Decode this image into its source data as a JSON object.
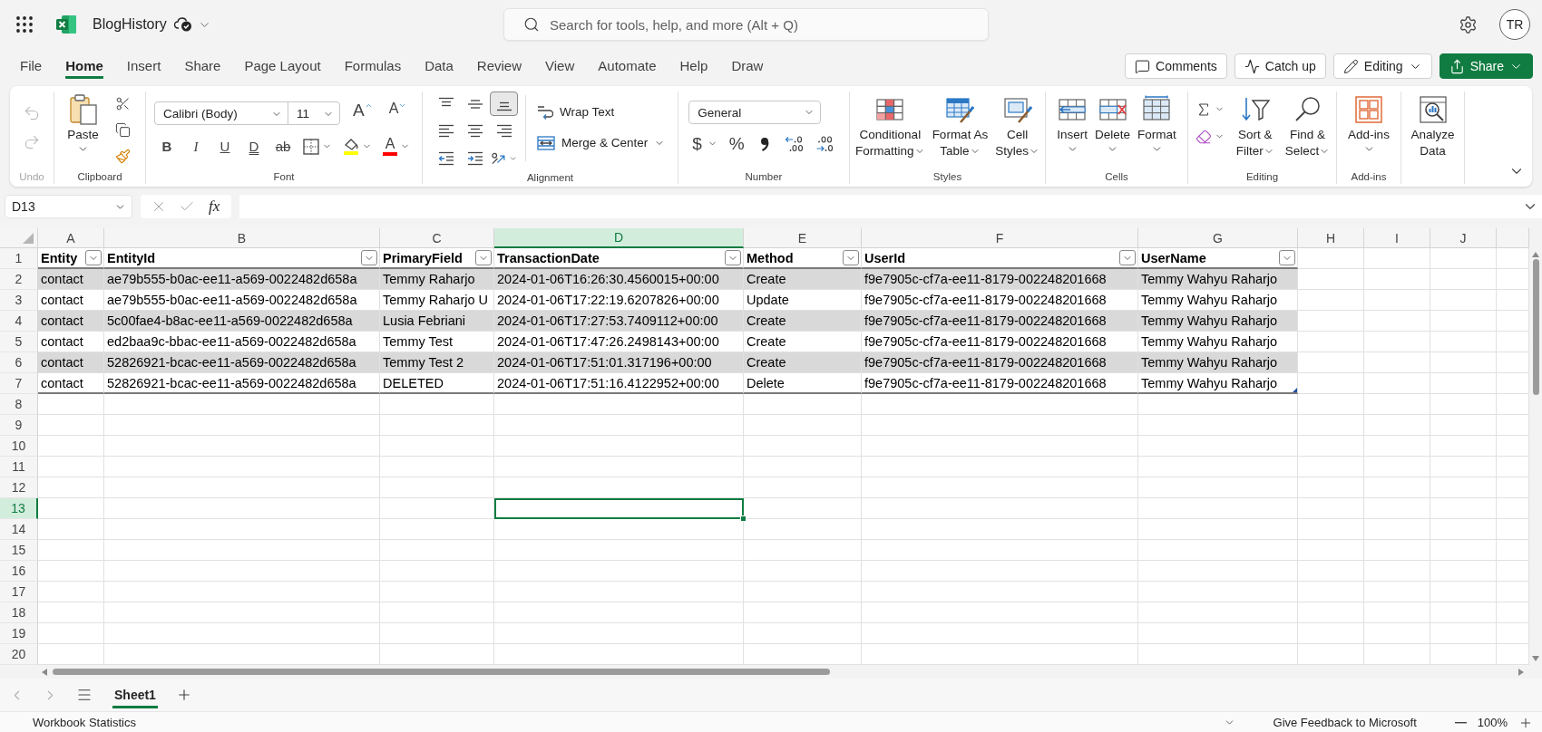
{
  "title_bar": {
    "file_name": "BlogHistory",
    "search": {
      "placeholder": "Search for tools, help, and more (Alt + Q)"
    },
    "avatar": "TR"
  },
  "ribbon_tabs": [
    {
      "label": "File",
      "selected": false
    },
    {
      "label": "Home",
      "selected": true
    },
    {
      "label": "Insert",
      "selected": false
    },
    {
      "label": "Share",
      "selected": false
    },
    {
      "label": "Page Layout",
      "selected": false
    },
    {
      "label": "Formulas",
      "selected": false
    },
    {
      "label": "Data",
      "selected": false
    },
    {
      "label": "Review",
      "selected": false
    },
    {
      "label": "View",
      "selected": false
    },
    {
      "label": "Automate",
      "selected": false
    },
    {
      "label": "Help",
      "selected": false
    },
    {
      "label": "Draw",
      "selected": false
    }
  ],
  "header_buttons": [
    {
      "kind": "comments",
      "label": "Comments"
    },
    {
      "kind": "catch_up",
      "label": "Catch up"
    },
    {
      "kind": "editing",
      "label": "Editing"
    },
    {
      "kind": "share",
      "label": "Share"
    }
  ],
  "ribbon": {
    "groups": [
      {
        "kind": "undo",
        "label": "Undo",
        "disabled": true
      },
      {
        "kind": "clipboard",
        "label": "Clipboard",
        "paste": "Paste"
      },
      {
        "kind": "font",
        "label": "Font",
        "font_name": "Calibri (Body)",
        "font_size": "11",
        "size_buttons": [
          {
            "kind": "grow",
            "label": "A"
          },
          {
            "kind": "shrink",
            "label": "A"
          }
        ],
        "style_buttons": [
          {
            "kind": "bold",
            "label": "B"
          },
          {
            "kind": "italic",
            "label": "I"
          },
          {
            "kind": "underline",
            "label": "U"
          },
          {
            "kind": "double_underline",
            "label": "D"
          },
          {
            "kind": "strikethrough",
            "label": "ab"
          }
        ],
        "highlight": {
          "color": "#ffff00"
        },
        "font_color": {
          "label": "A",
          "color": "#ff0000"
        }
      },
      {
        "kind": "alignment",
        "label": "Alignment",
        "align_buttons": [
          {
            "kind": "top",
            "selected": false
          },
          {
            "kind": "middle",
            "selected": false
          },
          {
            "kind": "bottom",
            "selected": true
          },
          {
            "kind": "left",
            "selected": false
          },
          {
            "kind": "center",
            "selected": false
          },
          {
            "kind": "right",
            "selected": false
          },
          {
            "kind": "outdent",
            "selected": false
          },
          {
            "kind": "indent",
            "selected": false
          },
          {
            "kind": "orientation",
            "selected": false
          }
        ],
        "wrap_text": "Wrap Text",
        "merge": "Merge & Center"
      },
      {
        "kind": "number",
        "label": "Number",
        "format": "General",
        "currency": "$",
        "percent": "%"
      },
      {
        "kind": "large",
        "label": "Styles",
        "buttons": [
          {
            "kind": "conditional_formatting",
            "lines": [
              "Conditional",
              "Formatting"
            ],
            "caret": true
          },
          {
            "kind": "format_as_table",
            "lines": [
              "Format As",
              "Table"
            ],
            "caret": true
          },
          {
            "kind": "cell_styles",
            "lines": [
              "Cell",
              "Styles"
            ],
            "caret": true
          }
        ]
      },
      {
        "kind": "large",
        "label": "Cells",
        "buttons": [
          {
            "kind": "insert",
            "lines": [
              "Insert"
            ],
            "caret": true
          },
          {
            "kind": "delete",
            "lines": [
              "Delete"
            ],
            "caret": true
          },
          {
            "kind": "format",
            "lines": [
              "Format"
            ],
            "caret": true
          }
        ]
      },
      {
        "kind": "editing",
        "label": "Editing",
        "buttons": [
          {
            "kind": "sort_filter",
            "lines": [
              "Sort &",
              "Filter"
            ],
            "caret": true
          },
          {
            "kind": "find_select",
            "lines": [
              "Find &",
              "Select"
            ],
            "caret": true
          }
        ]
      },
      {
        "kind": "large",
        "label": "Add-ins",
        "buttons": [
          {
            "kind": "add_ins",
            "lines": [
              "Add-ins"
            ],
            "caret": true
          }
        ]
      },
      {
        "kind": "large",
        "buttons": [
          {
            "kind": "analyze_data",
            "lines": [
              "Analyze",
              "Data"
            ],
            "caret": false
          }
        ]
      }
    ]
  },
  "formula_bar": {
    "name_box": "D13",
    "function_label": "fx"
  },
  "sheet": {
    "columns": [
      {
        "label": "A",
        "selected": false
      },
      {
        "label": "B",
        "selected": false
      },
      {
        "label": "C",
        "selected": false
      },
      {
        "label": "D",
        "selected": true
      },
      {
        "label": "E",
        "selected": false
      },
      {
        "label": "F",
        "selected": false
      },
      {
        "label": "G",
        "selected": false
      },
      {
        "label": "H",
        "selected": false
      },
      {
        "label": "I",
        "selected": false
      },
      {
        "label": "J",
        "selected": false
      }
    ],
    "row_headers": [
      {
        "label": "1",
        "selected": false
      },
      {
        "label": "2",
        "selected": false
      },
      {
        "label": "3",
        "selected": false
      },
      {
        "label": "4",
        "selected": false
      },
      {
        "label": "5",
        "selected": false
      },
      {
        "label": "6",
        "selected": false
      },
      {
        "label": "7",
        "selected": false
      },
      {
        "label": "8",
        "selected": false
      },
      {
        "label": "9",
        "selected": false
      },
      {
        "label": "10",
        "selected": false
      },
      {
        "label": "11",
        "selected": false
      },
      {
        "label": "12",
        "selected": false
      },
      {
        "label": "13",
        "selected": true
      },
      {
        "label": "14",
        "selected": false
      },
      {
        "label": "15",
        "selected": false
      },
      {
        "label": "16",
        "selected": false
      },
      {
        "label": "17",
        "selected": false
      },
      {
        "label": "18",
        "selected": false
      },
      {
        "label": "19",
        "selected": false
      },
      {
        "label": "20",
        "selected": false
      }
    ],
    "table": {
      "header": [
        "Entity",
        "EntityId",
        "PrimaryField",
        "TransactionDate",
        "Method",
        "UserId",
        "UserName"
      ],
      "rows": [
        [
          "contact",
          "ae79b555-b0ac-ee11-a569-0022482d658a",
          "Temmy Raharjo",
          "2024-01-06T16:26:30.4560015+00:00",
          "Create",
          "f9e7905c-cf7a-ee11-8179-002248201668",
          "Temmy Wahyu Raharjo"
        ],
        [
          "contact",
          "ae79b555-b0ac-ee11-a569-0022482d658a",
          "Temmy Raharjo U",
          "2024-01-06T17:22:19.6207826+00:00",
          "Update",
          "f9e7905c-cf7a-ee11-8179-002248201668",
          "Temmy Wahyu Raharjo"
        ],
        [
          "contact",
          "5c00fae4-b8ac-ee11-a569-0022482d658a",
          "Lusia Febriani",
          "2024-01-06T17:27:53.7409112+00:00",
          "Create",
          "f9e7905c-cf7a-ee11-8179-002248201668",
          "Temmy Wahyu Raharjo"
        ],
        [
          "contact",
          "ed2baa9c-bbac-ee11-a569-0022482d658a",
          "Temmy Test",
          "2024-01-06T17:47:26.2498143+00:00",
          "Create",
          "f9e7905c-cf7a-ee11-8179-002248201668",
          "Temmy Wahyu Raharjo"
        ],
        [
          "contact",
          "52826921-bcac-ee11-a569-0022482d658a",
          "Temmy Test 2",
          "2024-01-06T17:51:01.317196+00:00",
          "Create",
          "f9e7905c-cf7a-ee11-8179-002248201668",
          "Temmy Wahyu Raharjo"
        ],
        [
          "contact",
          "52826921-bcac-ee11-a569-0022482d658a",
          "DELETED",
          "2024-01-06T17:51:16.4122952+00:00",
          "Delete",
          "f9e7905c-cf7a-ee11-8179-002248201668",
          "Temmy Wahyu Raharjo"
        ]
      ]
    }
  },
  "sheet_tabs": [
    {
      "label": "Sheet1",
      "selected": true
    }
  ],
  "status_bar": {
    "left": "Workbook Statistics",
    "feedback": "Give Feedback to Microsoft",
    "zoom": "100%"
  }
}
